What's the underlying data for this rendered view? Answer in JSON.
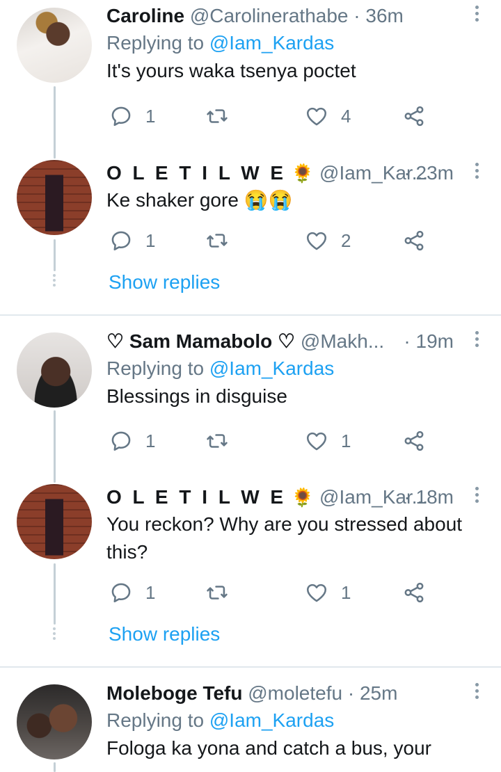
{
  "tweets": [
    {
      "name": "Caroline",
      "handle": "@Carolinerathabe",
      "time": "· 36m",
      "reply_prefix": "Replying to",
      "reply_mention": "@Iam_Kardas",
      "text": "It's yours waka tsenya poctet",
      "replies": "1",
      "likes": "4"
    },
    {
      "name": "O L E T I L W E",
      "emoji": "🌻",
      "handle": "@Iam_Kar...",
      "time": "· 23m",
      "text": "Ke shaker gore 😭😭",
      "replies": "1",
      "likes": "2",
      "show_replies": "Show replies"
    },
    {
      "name": "♡ Sam Mamabolo ♡",
      "handle": "@Makh...",
      "time": "· 19m",
      "reply_prefix": "Replying to",
      "reply_mention": "@Iam_Kardas",
      "text": "Blessings in disguise",
      "replies": "1",
      "likes": "1"
    },
    {
      "name": "O L E T I L W E",
      "emoji": "🌻",
      "handle": "@Iam_Kar...",
      "time": "· 18m",
      "text_line1": "You reckon? Why are you stressed about",
      "text_line2": "this?",
      "replies": "1",
      "likes": "1",
      "show_replies": "Show replies"
    },
    {
      "name": "Moleboge Tefu",
      "handle": "@moletefu",
      "time": "· 25m",
      "reply_prefix": "Replying to",
      "reply_mention": "@Iam_Kardas",
      "text": "Fologa ka yona  and catch a bus, your"
    }
  ],
  "colors": {
    "accent": "#1da1f2",
    "muted": "#657786",
    "thread": "#c4cfd6",
    "divider": "#e1e8ed"
  },
  "icons": [
    "reply-icon",
    "retweet-icon",
    "like-icon",
    "share-icon",
    "more-options-icon"
  ]
}
